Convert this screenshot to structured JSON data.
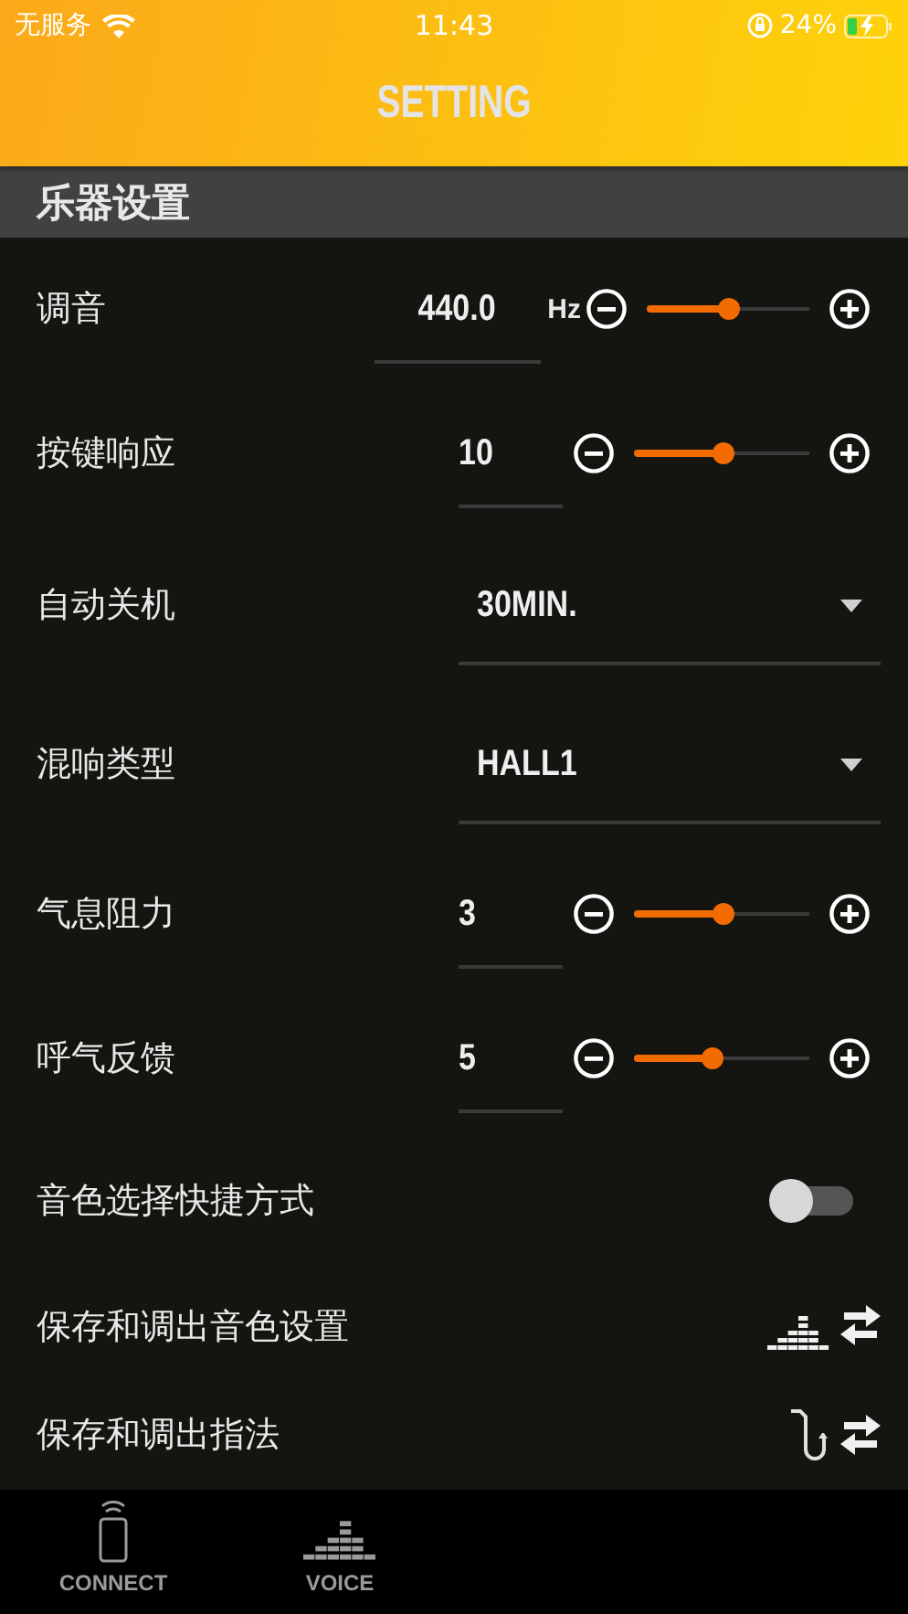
{
  "status_bar": {
    "carrier": "无服务",
    "time": "11:43",
    "battery": "24%"
  },
  "header": {
    "title": "SETTING"
  },
  "section": {
    "title": "乐器设置"
  },
  "rows": [
    {
      "kind": "slider",
      "label": "调音",
      "value": "440.0",
      "unit": "Hz",
      "level": 0.5
    },
    {
      "kind": "slider",
      "label": "按键响应",
      "value": "10",
      "level": 0.51
    },
    {
      "kind": "dropdown",
      "label": "自动关机",
      "value": "30MIN."
    },
    {
      "kind": "dropdown",
      "label": "混响类型",
      "value": "HALL1"
    },
    {
      "kind": "slider",
      "label": "气息阻力",
      "value": "3",
      "level": 0.51
    },
    {
      "kind": "slider",
      "label": "呼气反馈",
      "value": "5",
      "level": 0.45
    },
    {
      "kind": "toggle",
      "label": "音色选择快捷方式",
      "on": false
    },
    {
      "kind": "voicesave",
      "label": "保存和调出音色设置"
    },
    {
      "kind": "fingersave",
      "label": "保存和调出指法"
    }
  ],
  "tabs": [
    {
      "kind": "connect",
      "label": "CONNECT",
      "selected": false
    },
    {
      "kind": "voice",
      "label": "VOICE",
      "selected": false
    }
  ]
}
